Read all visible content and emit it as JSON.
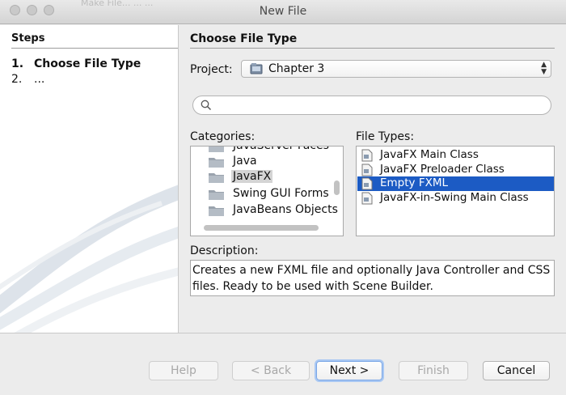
{
  "window": {
    "title": "New File",
    "ghost_title": "Make File... ...  ..."
  },
  "steps": {
    "header": "Steps",
    "items": [
      {
        "num": "1.",
        "label": "Choose File Type"
      },
      {
        "num": "2.",
        "label": "..."
      }
    ]
  },
  "main": {
    "title": "Choose File Type",
    "project_label": "Project:",
    "project_value": "Chapter 3",
    "search": {
      "value": "",
      "placeholder": ""
    },
    "categories_label": "Categories:",
    "categories": [
      "JavaServer Faces",
      "Java",
      "JavaFX",
      "Swing GUI Forms",
      "JavaBeans Objects"
    ],
    "selected_category": "JavaFX",
    "file_types_label": "File Types:",
    "file_types": [
      "JavaFX Main Class",
      "JavaFX Preloader Class",
      "Empty FXML",
      "JavaFX-in-Swing Main Class"
    ],
    "selected_file_type": "Empty FXML",
    "description_label": "Description:",
    "description": "Creates a new FXML file and optionally Java Controller and CSS files. Ready to be used with Scene Builder."
  },
  "buttons": {
    "help": "Help",
    "back": "< Back",
    "next": "Next >",
    "finish": "Finish",
    "cancel": "Cancel"
  },
  "colors": {
    "selection": "#1c5bc4",
    "category_selection": "#d4d4d4",
    "default_button_glow": "#a9c8f3"
  },
  "icons": [
    "project-icon",
    "search-icon",
    "folder-icon",
    "fxml-file-icon",
    "up-down-arrows-icon"
  ]
}
